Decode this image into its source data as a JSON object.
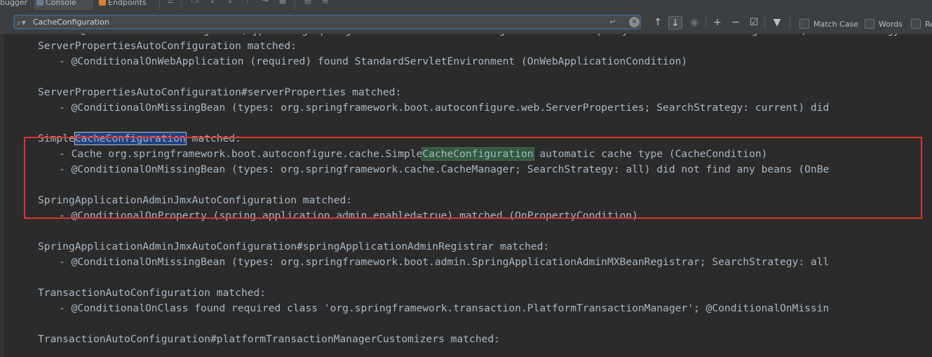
{
  "tabs": [
    {
      "label": "bugger",
      "active": false
    },
    {
      "label": "Console",
      "active": true
    },
    {
      "label": "Endpoints",
      "active": false
    }
  ],
  "search": {
    "value": "CacheConfiguration",
    "clear_icon": "clear-icon",
    "enter_icon": "enter-icon"
  },
  "find_options": {
    "match_case": "Match Case",
    "match_case_mnemonic": "C",
    "words": "Words",
    "words_mnemonic": "W",
    "regex": "Re"
  },
  "console_lines": [
    {
      "text": "@ConditionalOnMissingBean (types: org.springframework.boot.autoconfigure.context.PropertyPlaceholderAutoConfiguration; SearchStrategy:",
      "indent": 2
    },
    {
      "text": "ServerPropertiesAutoConfiguration matched:",
      "indent": 0
    },
    {
      "text": "- @ConditionalOnWebApplication (required) found StandardServletEnvironment (OnWebApplicationCondition)",
      "indent": 1
    },
    {
      "text": "",
      "indent": 0
    },
    {
      "text": "ServerPropertiesAutoConfiguration#serverProperties matched:",
      "indent": 0
    },
    {
      "text": "- @ConditionalOnMissingBean (types: org.springframework.boot.autoconfigure.web.ServerProperties; SearchStrategy: current) did",
      "indent": 1
    },
    {
      "text": "",
      "indent": 0
    },
    {
      "pre": "Simple",
      "match": "CacheConfiguration",
      "post": " matched:",
      "indent": 0,
      "selected": true
    },
    {
      "pre": "- Cache org.springframework.boot.autoconfigure.cache.Simple",
      "match": "CacheConfiguration",
      "post": " automatic cache type (CacheCondition)",
      "indent": 1,
      "selected": false
    },
    {
      "text": "- @ConditionalOnMissingBean (types: org.springframework.cache.CacheManager; SearchStrategy: all) did not find any beans (OnBe",
      "indent": 1
    },
    {
      "text": "",
      "indent": 0
    },
    {
      "text": "SpringApplicationAdminJmxAutoConfiguration matched:",
      "indent": 0
    },
    {
      "text": "- @ConditionalOnProperty (spring.application.admin.enabled=true) matched (OnPropertyCondition)",
      "indent": 1
    },
    {
      "text": "",
      "indent": 0
    },
    {
      "text": "SpringApplicationAdminJmxAutoConfiguration#springApplicationAdminRegistrar matched:",
      "indent": 0
    },
    {
      "text": "- @ConditionalOnMissingBean (types: org.springframework.boot.admin.SpringApplicationAdminMXBeanRegistrar; SearchStrategy: all",
      "indent": 1
    },
    {
      "text": "",
      "indent": 0
    },
    {
      "text": "TransactionAutoConfiguration matched:",
      "indent": 0
    },
    {
      "text": "- @ConditionalOnClass found required class 'org.springframework.transaction.PlatformTransactionManager'; @ConditionalOnMissin",
      "indent": 1
    },
    {
      "text": "",
      "indent": 0
    },
    {
      "text": "TransactionAutoConfiguration#platformTransactionManagerCustomizers matched:",
      "indent": 0
    }
  ],
  "colors": {
    "background": "#2b2b2b",
    "text": "#a9b7c6",
    "selected_match": "#214283",
    "other_match": "#32593d",
    "annotation_box": "#e0352b"
  }
}
